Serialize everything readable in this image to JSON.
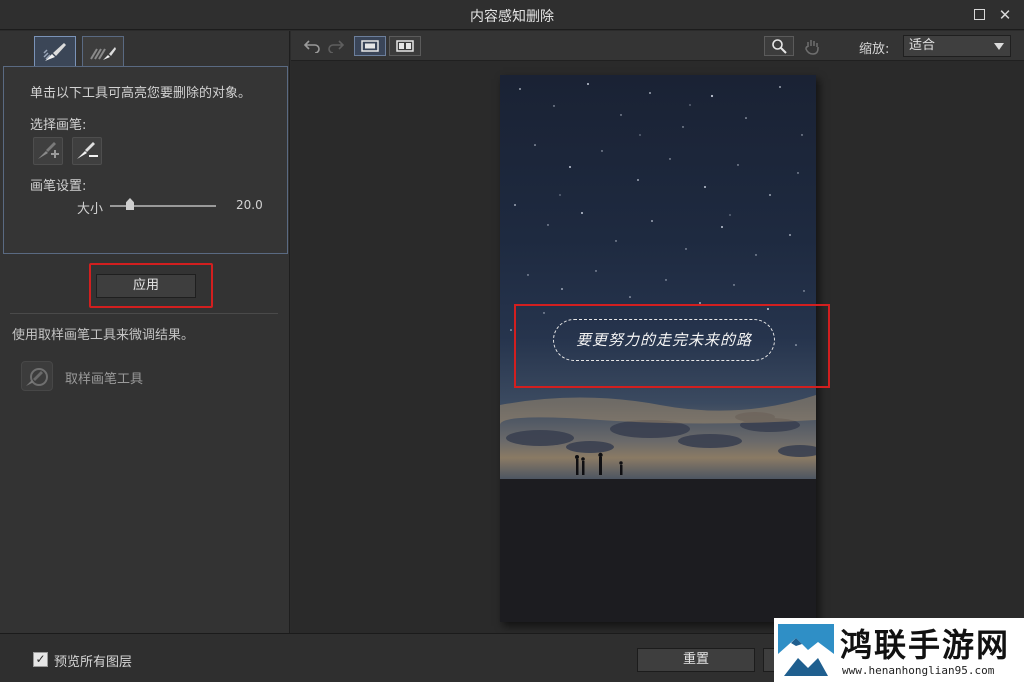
{
  "window": {
    "title": "内容感知删除"
  },
  "left_panel": {
    "instruction": "单击以下工具可高亮您要删除的对象。",
    "select_brush_label": "选择画笔:",
    "brush_settings_label": "画笔设置:",
    "size_label": "大小",
    "size_value": "20.0",
    "size_fraction": 0.17,
    "apply_label": "应用",
    "fine_tune_text": "使用取样画笔工具来微调结果。",
    "sample_tool_label": "取样画笔工具"
  },
  "toolbar": {
    "zoom_label": "缩放:",
    "zoom_value": "适合"
  },
  "canvas": {
    "caption_text": "要更努力的走完未来的路"
  },
  "bottom": {
    "preview_all_layers_label": "预览所有图层",
    "preview_checked": true,
    "reset_label": "重置"
  },
  "watermark": {
    "name": "鸿联手游网",
    "url": "www.henanhonglian95.com"
  },
  "colors": {
    "highlight_red": "#d21f1f",
    "accent_blue": "#6c7f9c"
  }
}
